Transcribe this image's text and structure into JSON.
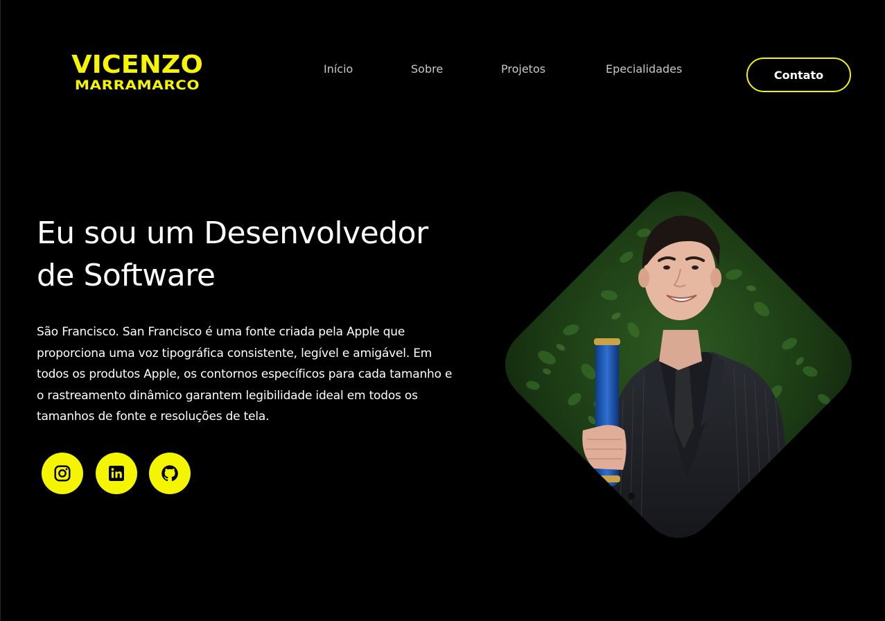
{
  "logo": {
    "first_name": "VICENZO",
    "last_name": "MARRAMARCO"
  },
  "nav": {
    "items": [
      {
        "label": "Início"
      },
      {
        "label": "Sobre"
      },
      {
        "label": "Projetos"
      },
      {
        "label": "Epecialidades"
      }
    ],
    "contact_label": "Contato"
  },
  "hero": {
    "title_line1": "Eu sou um Desenvolvedor",
    "title_line2": "de Software",
    "description": "São Francisco. San Francisco é uma fonte criada pela Apple que proporciona uma voz tipográfica consistente, legível e amigável. Em todos os produtos Apple, os contornos específicos para cada tamanho e o rastreamento dinâmico garantem legibilidade ideal em todos os tamanhos de fonte e resoluções de tela."
  },
  "socials": [
    {
      "icon": "instagram-icon"
    },
    {
      "icon": "linkedin-icon"
    },
    {
      "icon": "github-icon"
    }
  ],
  "colors": {
    "accent": "#f5f500",
    "background": "#000000",
    "text": "#ffffff",
    "nav_text": "#c9c9c9"
  }
}
